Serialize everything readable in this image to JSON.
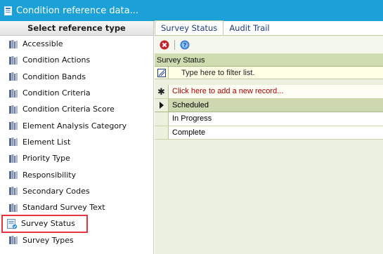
{
  "window": {
    "title": "Condition reference data..."
  },
  "left_panel": {
    "header": "Select reference type",
    "items": [
      {
        "label": "Accessible",
        "selected": false
      },
      {
        "label": "Condition Actions",
        "selected": false
      },
      {
        "label": "Condition Bands",
        "selected": false
      },
      {
        "label": "Condition Criteria",
        "selected": false
      },
      {
        "label": "Condition Criteria Score",
        "selected": false
      },
      {
        "label": "Element Analysis Category",
        "selected": false
      },
      {
        "label": "Element List",
        "selected": false
      },
      {
        "label": "Priority Type",
        "selected": false
      },
      {
        "label": "Responsibility",
        "selected": false
      },
      {
        "label": "Secondary Codes",
        "selected": false
      },
      {
        "label": "Standard Survey Text",
        "selected": false
      },
      {
        "label": "Survey Status",
        "selected": true
      },
      {
        "label": "Survey Types",
        "selected": false
      }
    ]
  },
  "tabs": [
    {
      "label": "Survey Status",
      "active": true
    },
    {
      "label": "Audit Trail",
      "active": false
    }
  ],
  "toolbar": {
    "delete_icon": "delete-icon",
    "help_icon": "help-icon"
  },
  "grid": {
    "caption": "Survey Status",
    "filter_placeholder": "Type here to filter list.",
    "add_new_text": "Click here to add a new record...",
    "rows": [
      "Scheduled",
      "In Progress",
      "Complete"
    ],
    "selected_row": 0
  },
  "colors": {
    "titlebar": "#1ba1d8",
    "selection_outline": "#e8343e",
    "grid_background": "#ebf1de"
  }
}
